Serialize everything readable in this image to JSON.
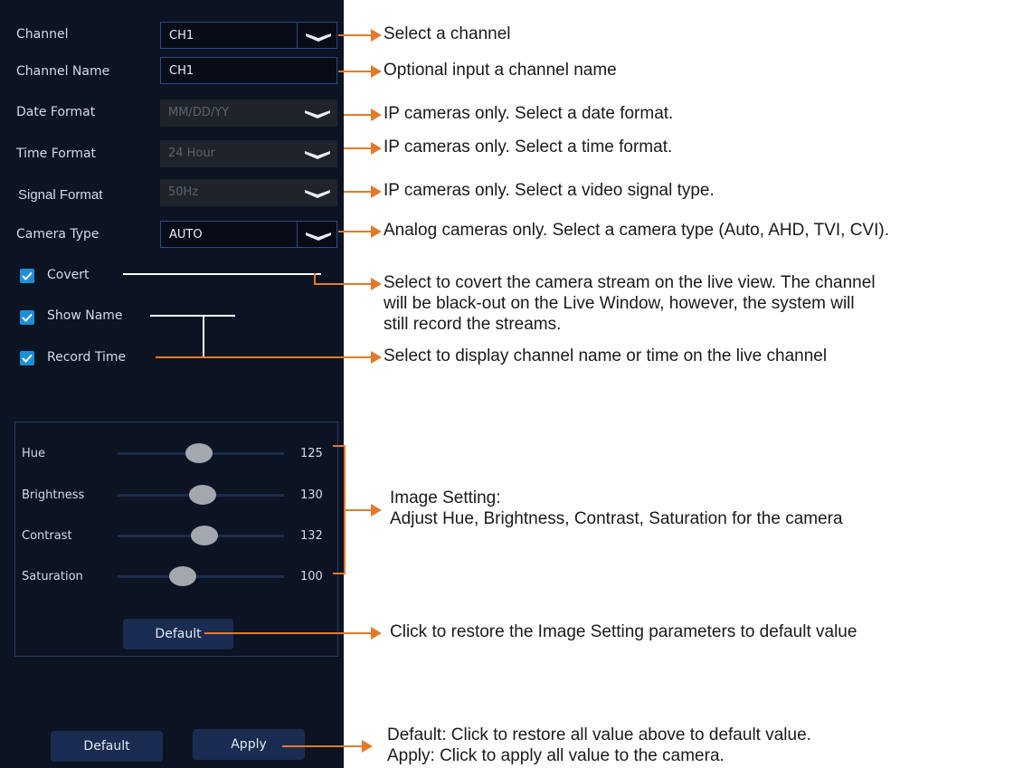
{
  "settings": {
    "channel": {
      "label": "Channel",
      "value": "CH1"
    },
    "channel_name": {
      "label": "Channel Name",
      "value": "CH1"
    },
    "date_format": {
      "label": "Date Format",
      "value": "MM/DD/YY"
    },
    "time_format": {
      "label": "Time Format",
      "value": "24 Hour"
    },
    "signal_format": {
      "label": "Signal Format",
      "value": "50Hz"
    },
    "camera_type": {
      "label": "Camera Type",
      "value": "AUTO"
    }
  },
  "checkboxes": {
    "covert": {
      "label": "Covert",
      "checked": true
    },
    "show_name": {
      "label": "Show Name",
      "checked": true
    },
    "record_time": {
      "label": "Record Time",
      "checked": true
    }
  },
  "image_setting": {
    "hue": {
      "label": "Hue",
      "value": "125",
      "level": 0.49
    },
    "brightness": {
      "label": "Brightness",
      "value": "130",
      "level": 0.51
    },
    "contrast": {
      "label": "Contrast",
      "value": "132",
      "level": 0.52
    },
    "saturation": {
      "label": "Saturation",
      "value": "100",
      "level": 0.39
    },
    "default_label": "Default"
  },
  "footer": {
    "default_label": "Default",
    "apply_label": "Apply"
  },
  "annotations": {
    "channel": "Select a channel",
    "channel_name": "Optional input a channel name",
    "date_format": "IP cameras only. Select a date format.",
    "time_format": "IP cameras only. Select a time format.",
    "signal_format": "IP cameras only. Select a video signal type.",
    "camera_type": "Analog cameras only. Select a camera type (Auto, AHD, TVI, CVI).",
    "covert_1": "Select to covert the camera stream on the live view. The channel",
    "covert_2": "will be black-out on the Live Window, however, the system will",
    "covert_3": "still record the streams.",
    "display": "Select to display channel name or time on the live channel",
    "image_1": "Image Setting:",
    "image_2": "Adjust Hue, Brightness, Contrast, Saturation for the camera",
    "image_default": "Click to restore the Image Setting parameters to default value",
    "footer_1": "Default: Click to restore all value above to default value.",
    "footer_2": "Apply: Click to apply all value to the camera."
  },
  "colors": {
    "panel_bg": "#0c1323",
    "accent": "#e37a2a",
    "checkbox": "#1e8fd4",
    "field_border": "#2b4a86"
  }
}
